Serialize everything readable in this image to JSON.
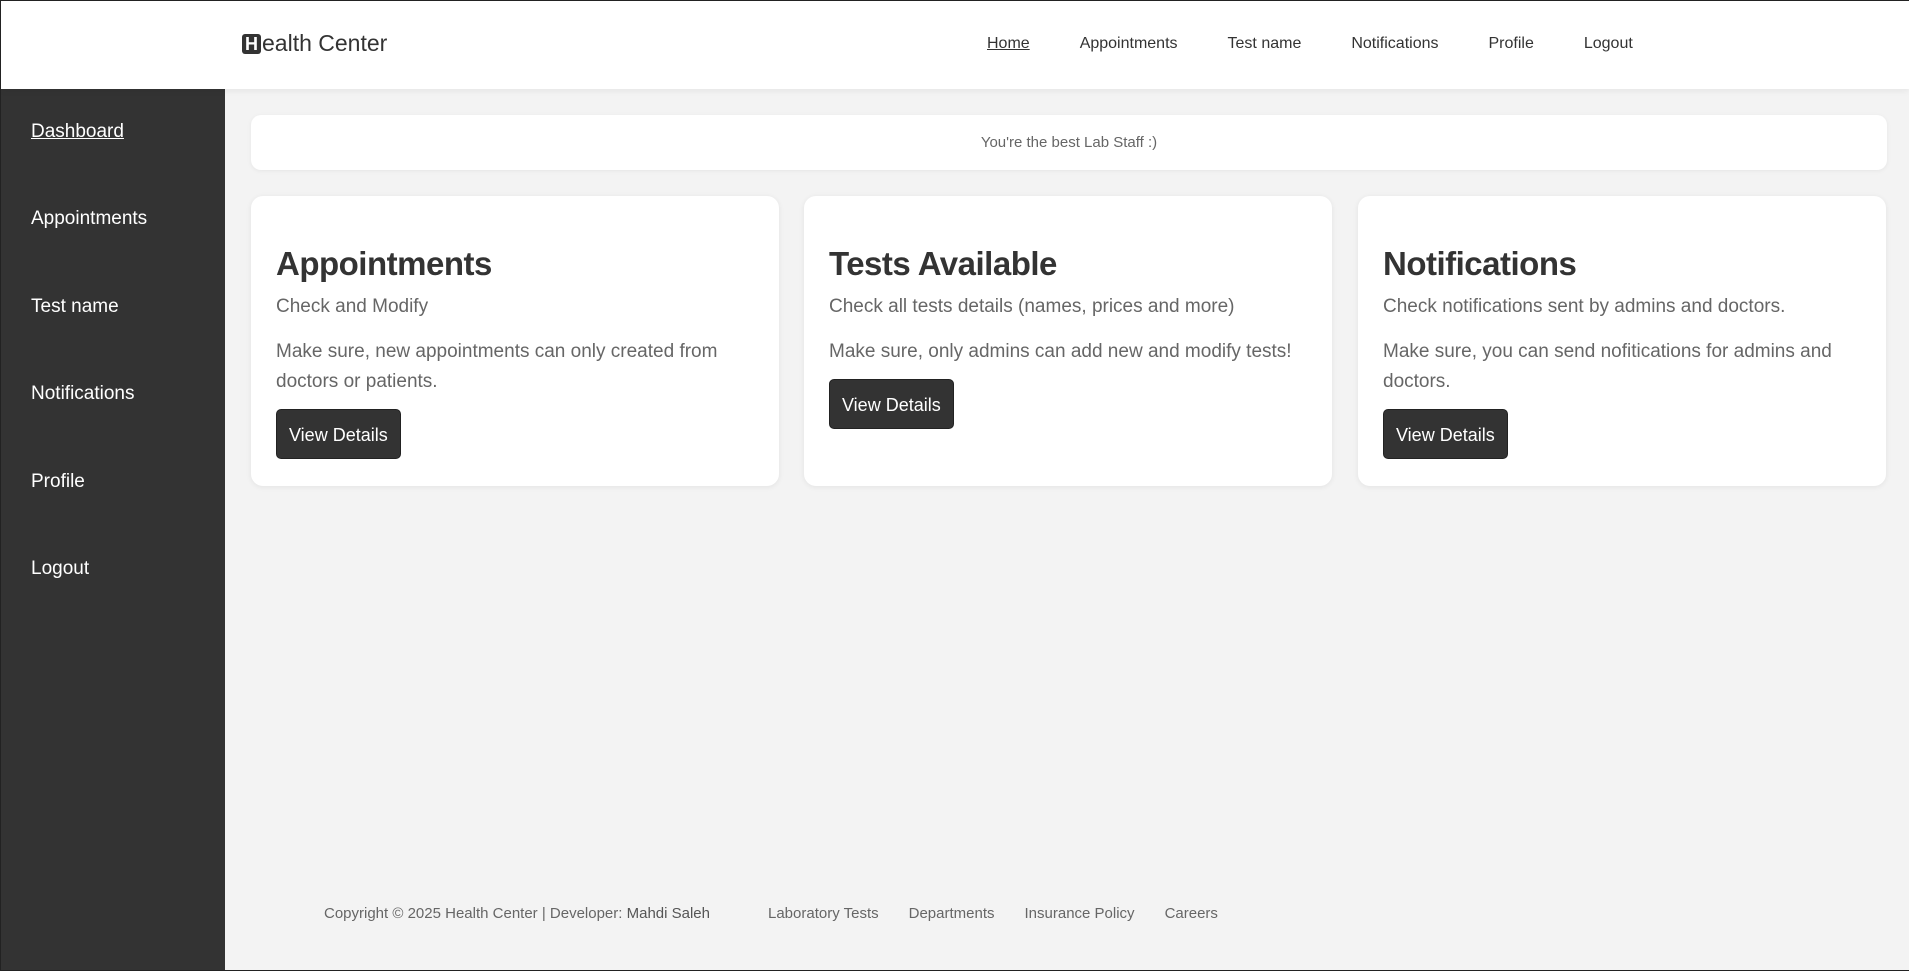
{
  "header": {
    "logo_mark": "H",
    "logo_text": "ealth Center",
    "nav": [
      {
        "label": "Home"
      },
      {
        "label": "Appointments"
      },
      {
        "label": "Test name"
      },
      {
        "label": "Notifications"
      },
      {
        "label": "Profile"
      },
      {
        "label": "Logout"
      }
    ]
  },
  "sidebar": {
    "items": [
      {
        "label": "Dashboard"
      },
      {
        "label": "Appointments"
      },
      {
        "label": "Test name"
      },
      {
        "label": "Notifications"
      },
      {
        "label": "Profile"
      },
      {
        "label": "Logout"
      }
    ]
  },
  "banner": {
    "text": "You're the best Lab Staff :)"
  },
  "cards": [
    {
      "title": "Appointments",
      "subtitle": "Check and Modify",
      "description": "Make sure, new appointments can only created from doctors or patients.",
      "button": "View Details"
    },
    {
      "title": "Tests Available",
      "subtitle": "Check all tests details (names, prices and more)",
      "description": "Make sure, only admins can add new and modify tests!",
      "button": "View Details"
    },
    {
      "title": "Notifications",
      "subtitle": "Check notifications sent by admins and doctors.",
      "description": "Make sure, you can send nofitications for admins and doctors.",
      "button": "View Details"
    }
  ],
  "footer": {
    "copyright": "Copyright © 2025 Health Center | Developer: ",
    "developer": "Mahdi Saleh",
    "links": [
      {
        "label": "Laboratory Tests"
      },
      {
        "label": "Departments"
      },
      {
        "label": "Insurance Policy"
      },
      {
        "label": "Careers"
      }
    ]
  },
  "colors": {
    "sidebar_bg": "#333333",
    "page_bg": "#f3f3f3",
    "button_bg": "#333333"
  }
}
